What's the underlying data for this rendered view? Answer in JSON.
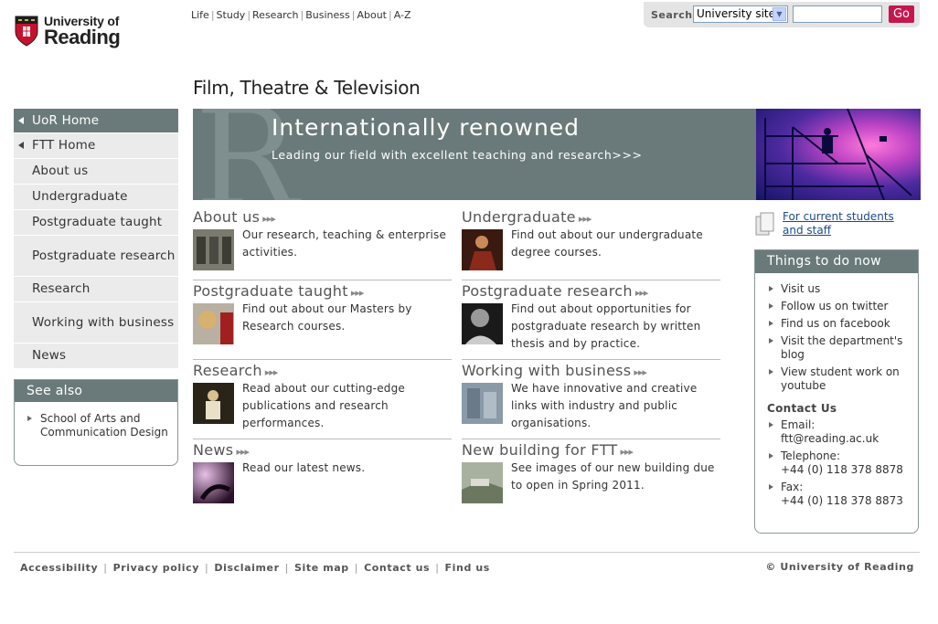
{
  "logo": {
    "line1": "University of",
    "line2": "Reading"
  },
  "toplinks": [
    "Life",
    "Study",
    "Research",
    "Business",
    "About",
    "A-Z"
  ],
  "search": {
    "label": "Search",
    "scope": "University site",
    "go": "Go"
  },
  "site_title": "Film, Theatre & Television",
  "nav": {
    "home": "UoR Home",
    "ftt": "FTT Home",
    "items": [
      "About us",
      "Undergraduate",
      "Postgraduate taught",
      "Postgraduate research",
      "Research",
      "Working with business",
      "News"
    ]
  },
  "see_also": {
    "title": "See also",
    "items": [
      "School of Arts and Communication Design"
    ]
  },
  "banner": {
    "heading": "Internationally renowned",
    "sub": "Leading our field with excellent teaching and research>>>"
  },
  "blocks": [
    {
      "title": "About us",
      "desc": "Our research, teaching & enterprise activities."
    },
    {
      "title": "Undergraduate",
      "desc": "Find out about our undergraduate degree courses."
    },
    {
      "title": "Postgraduate taught",
      "desc": "Find out about our Masters by Research courses."
    },
    {
      "title": "Postgraduate research",
      "desc": "Find out about opportunities for postgraduate research by written thesis and by practice."
    },
    {
      "title": "Research",
      "desc": "Read about our cutting-edge publications and research performances."
    },
    {
      "title": "Working with business",
      "desc": "We have innovative and creative links with industry and public organisations."
    },
    {
      "title": "News",
      "desc": "Read our latest news."
    },
    {
      "title": "New building for FTT",
      "desc": "See images of our new building due to open in Spring 2011."
    }
  ],
  "arrows": "▸▸▸",
  "students_link": "For current students and staff",
  "todo": {
    "title": "Things to do now",
    "items": [
      "Visit us",
      "Follow us on twitter",
      "Find us on facebook",
      "Visit the department's blog",
      "View student work on youtube"
    ],
    "contact_title": "Contact Us",
    "contacts": [
      {
        "label": "Email:",
        "value": "ftt@reading.ac.uk"
      },
      {
        "label": "Telephone:",
        "value": "+44 (0) 118 378 8878"
      },
      {
        "label": "Fax:",
        "value": "+44 (0) 118 378 8873"
      }
    ]
  },
  "footer": [
    "Accessibility",
    "Privacy policy",
    "Disclaimer",
    "Site map",
    "Contact us",
    "Find us"
  ],
  "copyright": "© University of Reading",
  "colors": {
    "nav_dark": "#6a7a7a",
    "go_button": "#c5164f",
    "link_blue": "#1c4a8a"
  }
}
